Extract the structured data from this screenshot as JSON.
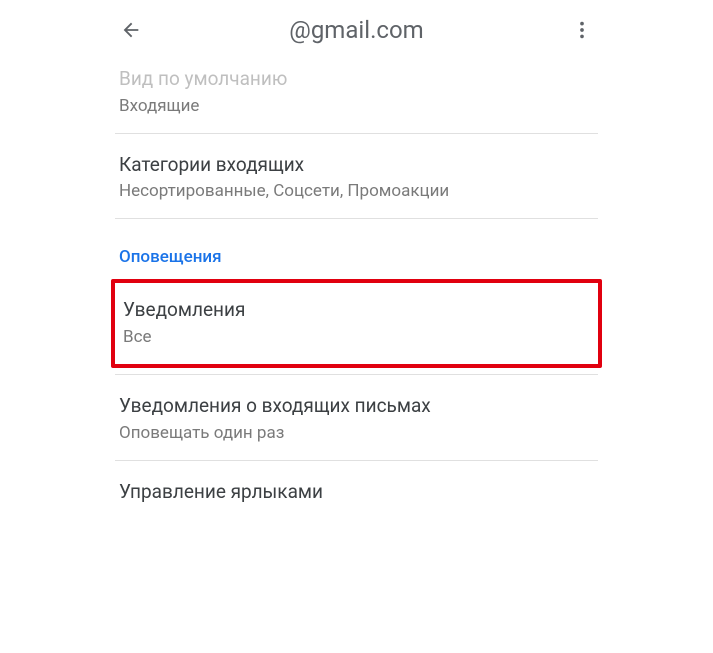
{
  "header": {
    "title": "@gmail.com"
  },
  "settings": {
    "default_view": {
      "title": "Вид по умолчанию",
      "subtitle": "Входящие"
    },
    "inbox_categories": {
      "title": "Категории входящих",
      "subtitle": "Несортированные, Соцсети, Промоакции"
    },
    "section_notifications": "Оповещения",
    "notifications": {
      "title": "Уведомления",
      "subtitle": "Все"
    },
    "email_notifications": {
      "title": "Уведомления о входящих письмах",
      "subtitle": "Оповещать один раз"
    },
    "manage_labels": {
      "title": "Управление ярлыками"
    }
  }
}
